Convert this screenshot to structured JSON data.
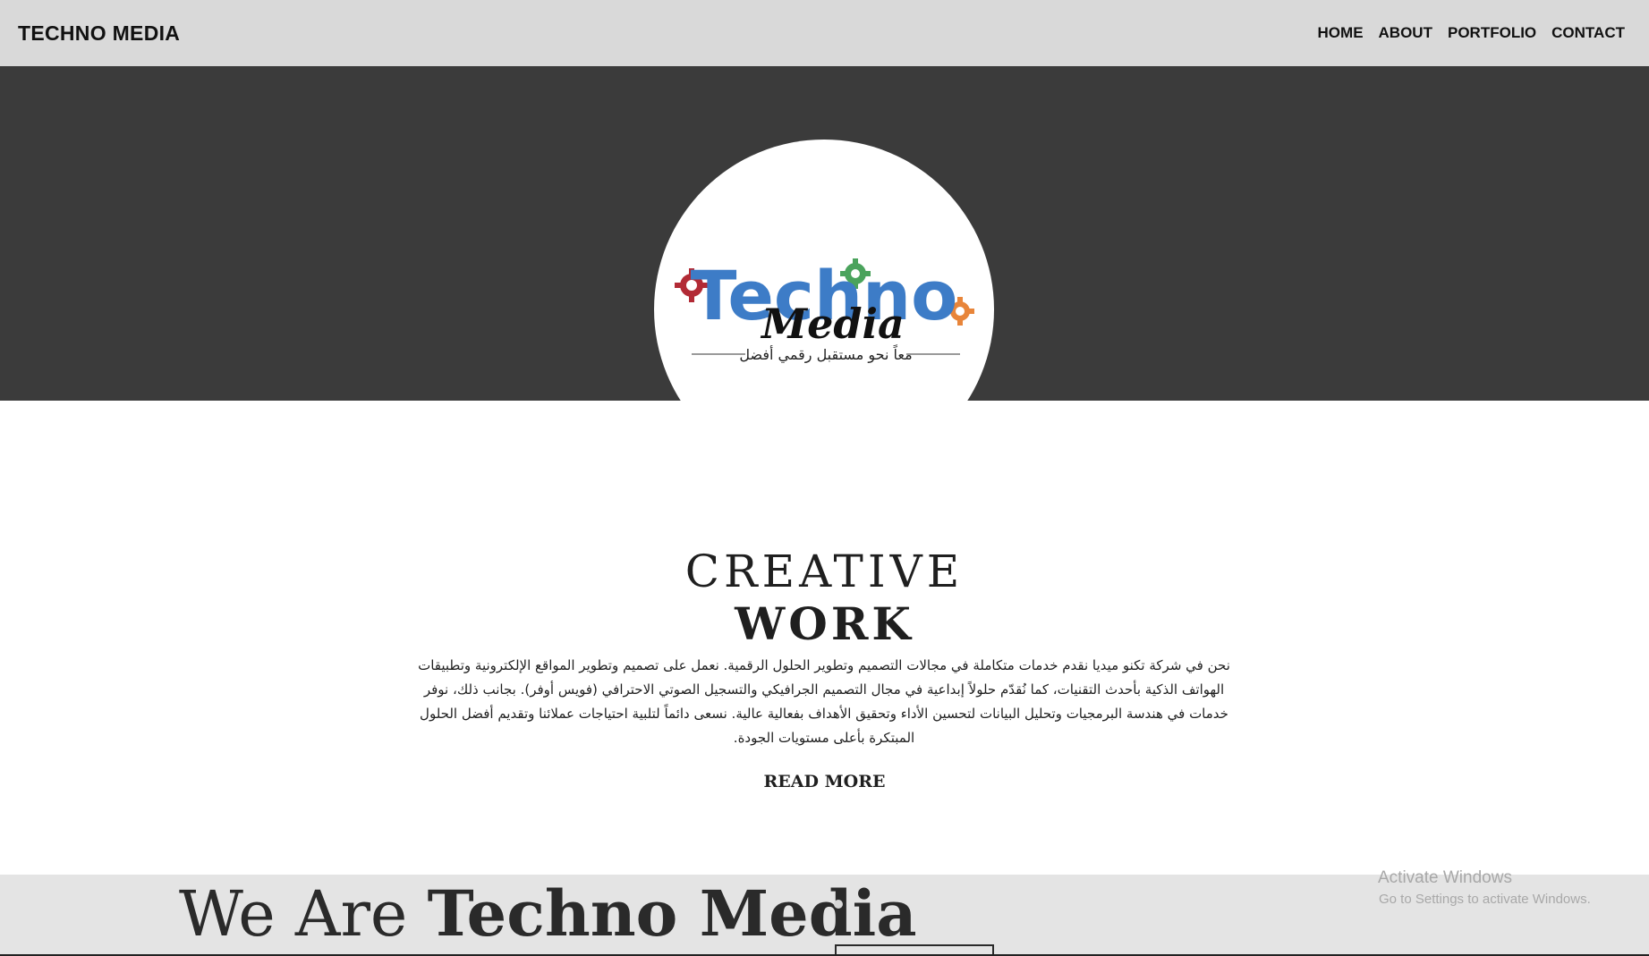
{
  "header": {
    "brand": "TECHNO MEDIA",
    "nav": [
      "HOME",
      "ABOUT",
      "PORTFOLIO",
      "CONTACT"
    ]
  },
  "hero": {
    "logo": {
      "word1": "Techno",
      "word2": "Media",
      "tagline": "معاً نحو مستقبل رقمي أفضل",
      "colors": {
        "blue": "#3d7cc7",
        "red": "#b22a35",
        "green": "#4aa35c",
        "orange": "#e8853a",
        "black": "#111111"
      }
    },
    "background": "#3b3b3b"
  },
  "section": {
    "title_light": "CREATIVE",
    "title_bold": "WORK",
    "paragraph": "نحن في شركة تكنو ميديا نقدم خدمات متكاملة في مجالات التصميم وتطوير الحلول الرقمية. نعمل على تصميم وتطوير المواقع الإلكترونية وتطبيقات الهواتف الذكية بأحدث التقنيات، كما نُقدّم حلولاً إبداعية في مجال التصميم الجرافيكي والتسجيل الصوتي الاحترافي (فويس أوفر). بجانب ذلك، نوفر خدمات في هندسة البرمجيات وتحليل البيانات لتحسين الأداء وتحقيق الأهداف بفعالية عالية. نسعى دائماً لتلبية احتياجات عملائنا وتقديم أفضل الحلول المبتكرة بأعلى مستويات الجودة.",
    "read_more": "READ MORE"
  },
  "bottom": {
    "we_are": "We Are",
    "brand_name": "Techno Media"
  },
  "watermark": {
    "title": "Activate Windows",
    "subtitle": "Go to Settings to activate Windows."
  }
}
